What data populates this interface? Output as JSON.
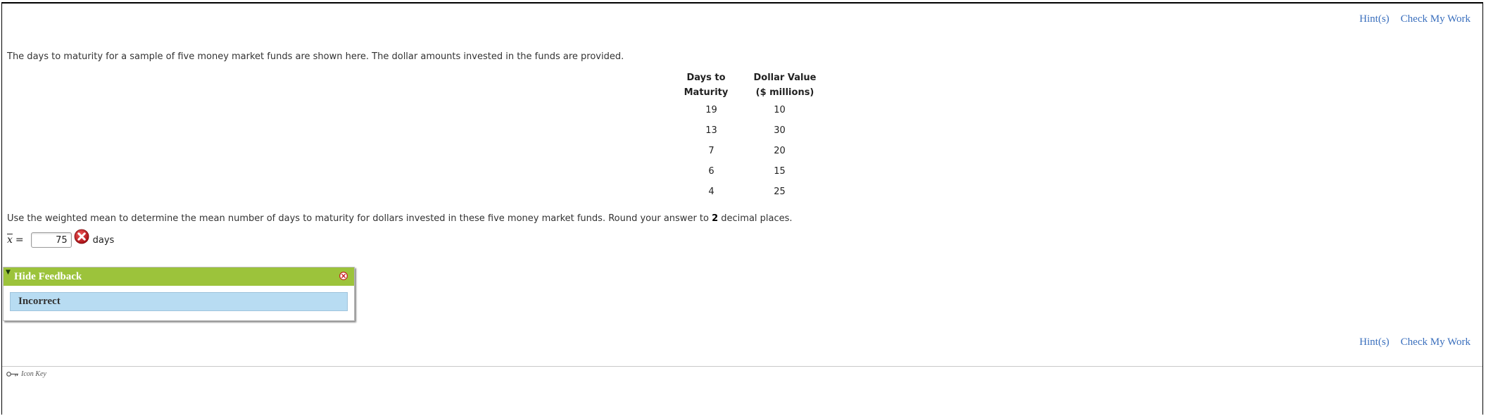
{
  "links": {
    "hints": "Hint(s)",
    "check": "Check My Work"
  },
  "intro_text": "The days to maturity for a sample of five money market funds are shown here. The dollar amounts invested in the funds are provided.",
  "table": {
    "headers": [
      {
        "line1": "Days to",
        "line2": "Maturity"
      },
      {
        "line1": "Dollar Value",
        "line2": "($ millions)"
      }
    ],
    "rows": [
      [
        "19",
        "10"
      ],
      [
        "13",
        "30"
      ],
      [
        "7",
        "20"
      ],
      [
        "6",
        "15"
      ],
      [
        "4",
        "25"
      ]
    ]
  },
  "question": {
    "before": "Use the weighted mean to determine the mean number of days to maturity for dollars invested in these five money market funds. Round your answer to ",
    "bold": "2",
    "after": " decimal places."
  },
  "answer": {
    "symbol": "x",
    "equals": "=",
    "value": "75",
    "unit": "days",
    "status_icon": "incorrect-x-icon"
  },
  "feedback": {
    "title": "Hide Feedback",
    "message": "Incorrect",
    "header_color": "#9cc33b",
    "body_color": "#b8dcf2"
  },
  "footer": {
    "icon_key_label": "Icon Key"
  },
  "colors": {
    "link": "#3a6fbd",
    "error_red": "#c8161d"
  }
}
